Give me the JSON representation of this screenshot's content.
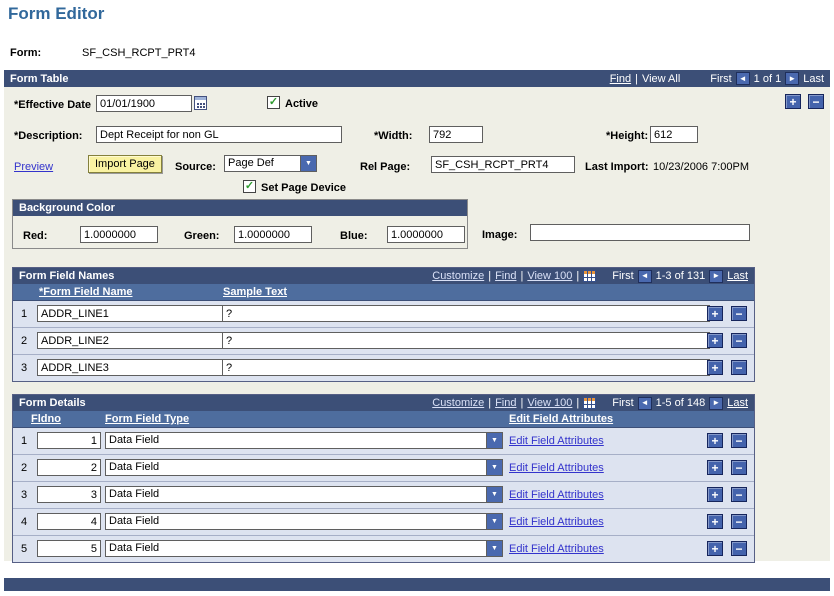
{
  "page": {
    "title": "Form Editor"
  },
  "ui": {
    "sep": "|"
  },
  "icons": {
    "prev": "◄",
    "next": "►",
    "dropdown": "▼",
    "check": "✓",
    "plus": "+",
    "minus": "−"
  },
  "form_ref": {
    "label": "Form:",
    "value": "SF_CSH_RCPT_PRT4"
  },
  "form_table": {
    "title": "Form Table",
    "nav": {
      "find": "Find",
      "view_all": "View All",
      "first": "First",
      "count": "1 of 1",
      "last": "Last"
    },
    "effective_date": {
      "label": "*Effective Date",
      "value": "01/01/1900"
    },
    "active_label": "Active",
    "description": {
      "label": "*Description:",
      "value": "Dept Receipt for non GL"
    },
    "width": {
      "label": "*Width:",
      "value": "792"
    },
    "height": {
      "label": "*Height:",
      "value": "612"
    },
    "preview_label": "Preview",
    "import_button_label": "Import Page",
    "source": {
      "label": "Source:",
      "value": "Page Def"
    },
    "rel_page": {
      "label": "Rel Page:",
      "value": "SF_CSH_RCPT_PRT4"
    },
    "last_import": {
      "label": "Last Import:",
      "value": "10/23/2006 7:00PM"
    },
    "set_page_device_label": "Set Page Device",
    "background_color": {
      "title": "Background Color",
      "red": {
        "label": "Red:",
        "value": "1.0000000"
      },
      "green": {
        "label": "Green:",
        "value": "1.0000000"
      },
      "blue": {
        "label": "Blue:",
        "value": "1.0000000"
      }
    },
    "image": {
      "label": "Image:",
      "value": ""
    }
  },
  "form_field_names": {
    "title": "Form Field Names",
    "toolbar": {
      "customize": "Customize",
      "find": "Find",
      "view": "View 100",
      "first": "First",
      "range": "1-3 of 131",
      "last": "Last"
    },
    "columns": [
      "*Form Field Name",
      "Sample Text"
    ],
    "rows": [
      {
        "num": "1",
        "name": "ADDR_LINE1",
        "sample": "?"
      },
      {
        "num": "2",
        "name": "ADDR_LINE2",
        "sample": "?"
      },
      {
        "num": "3",
        "name": "ADDR_LINE3",
        "sample": "?"
      }
    ]
  },
  "form_details": {
    "title": "Form Details",
    "toolbar": {
      "customize": "Customize",
      "find": "Find",
      "view": "View 100",
      "first": "First",
      "range": "1-5 of 148",
      "last": "Last"
    },
    "columns": [
      "Fldno",
      "Form Field Type",
      "Edit Field Attributes"
    ],
    "rows": [
      {
        "num": "1",
        "fldno": "1",
        "type": "Data Field",
        "link": "Edit Field Attributes"
      },
      {
        "num": "2",
        "fldno": "2",
        "type": "Data Field",
        "link": "Edit Field Attributes"
      },
      {
        "num": "3",
        "fldno": "3",
        "type": "Data Field",
        "link": "Edit Field Attributes"
      },
      {
        "num": "4",
        "fldno": "4",
        "type": "Data Field",
        "link": "Edit Field Attributes"
      },
      {
        "num": "5",
        "fldno": "5",
        "type": "Data Field",
        "link": "Edit Field Attributes"
      }
    ]
  },
  "colors": {
    "header_bar": "#3C4F77",
    "grid_header": "#4E6D9E",
    "row_bg": "#DDE3F0",
    "body_bg": "#EFEFE6",
    "link": "#3333CC",
    "button_yellow": "#F9F2A2",
    "title": "#31689B",
    "check_green": "#2E9B2E",
    "control_blue": "#4A69AF"
  }
}
